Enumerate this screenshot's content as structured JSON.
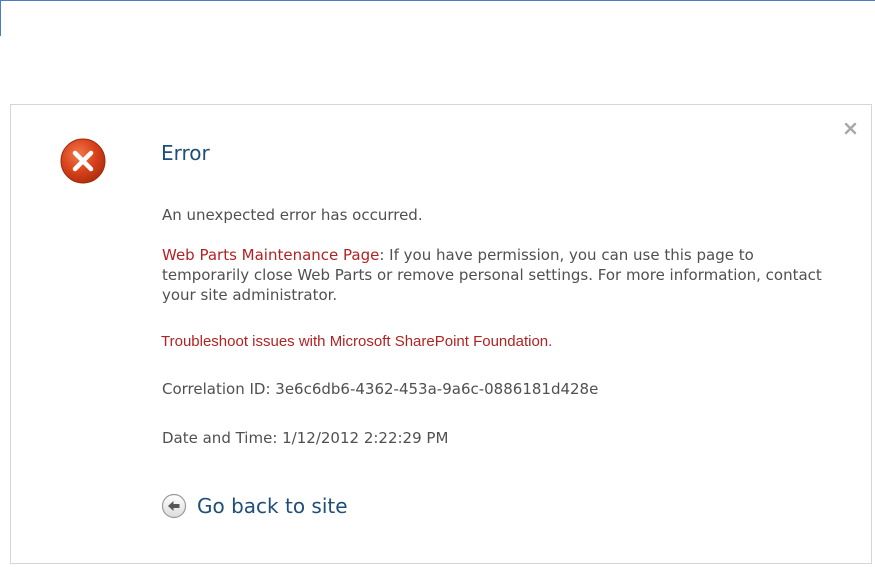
{
  "dialog": {
    "title": "Error",
    "message": "An unexpected error has occurred.",
    "maintenance_link": "Web Parts Maintenance Page",
    "maintenance_text": ": If you have permission, you can use this page to temporarily close Web Parts or remove personal settings. For more information, contact your site administrator.",
    "troubleshoot_link": "Troubleshoot issues with Microsoft SharePoint Foundation.",
    "correlation": "Correlation ID: 3e6c6db6-4362-453a-9a6c-0886181d428e",
    "datetime": "Date and Time: 1/12/2012 2:22:29 PM",
    "go_back_label": "Go back to site",
    "icons": {
      "error": "error-x-icon",
      "close": "close-icon",
      "back": "back-arrow-icon"
    }
  },
  "colors": {
    "title": "#1f4e79",
    "link_red": "#b22222",
    "body_text": "#505050",
    "error_icon": "#d9421c",
    "border": "#d6d6d6",
    "top_line": "#4a7cc0"
  }
}
